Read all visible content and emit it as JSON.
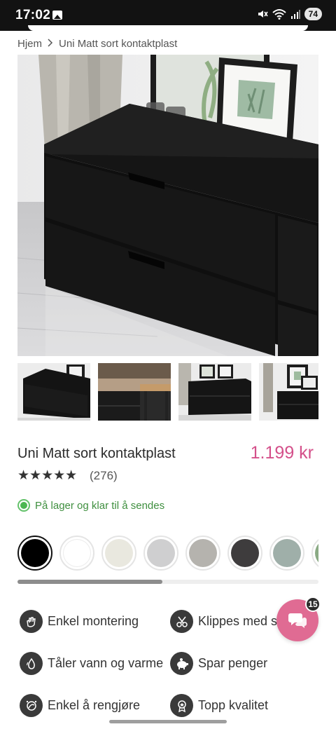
{
  "status": {
    "time": "17:02",
    "battery": "74"
  },
  "breadcrumb": {
    "home": "Hjem",
    "current": "Uni Matt sort kontaktplast"
  },
  "product": {
    "title": "Uni Matt sort kontaktplast",
    "price": "1.199 kr",
    "stars": "★★★★★",
    "reviews": "(276)",
    "stock": "På lager og klar til å sendes"
  },
  "swatches": [
    {
      "name": "black",
      "color": "#000000",
      "selected": true
    },
    {
      "name": "white",
      "color": "#ffffff"
    },
    {
      "name": "cream",
      "color": "#e9e8df"
    },
    {
      "name": "light-grey",
      "color": "#cfcfd0"
    },
    {
      "name": "warm-grey",
      "color": "#b5b3ae"
    },
    {
      "name": "dark-grey",
      "color": "#3e3c3d"
    },
    {
      "name": "sage-grey",
      "color": "#9fafa9"
    },
    {
      "name": "green",
      "color": "#8aaa84"
    }
  ],
  "features": {
    "f1": "Enkel montering",
    "f2": "Klippes med saks",
    "f3": "Tåler vann og varme",
    "f4": "Spar penger",
    "f5": "Enkel å rengjøre",
    "f6": "Topp kvalitet"
  },
  "chat": {
    "badge": "15"
  },
  "colors": {
    "accent": "#d4508a",
    "stock": "#4cb752",
    "chat": "#e06b93"
  }
}
